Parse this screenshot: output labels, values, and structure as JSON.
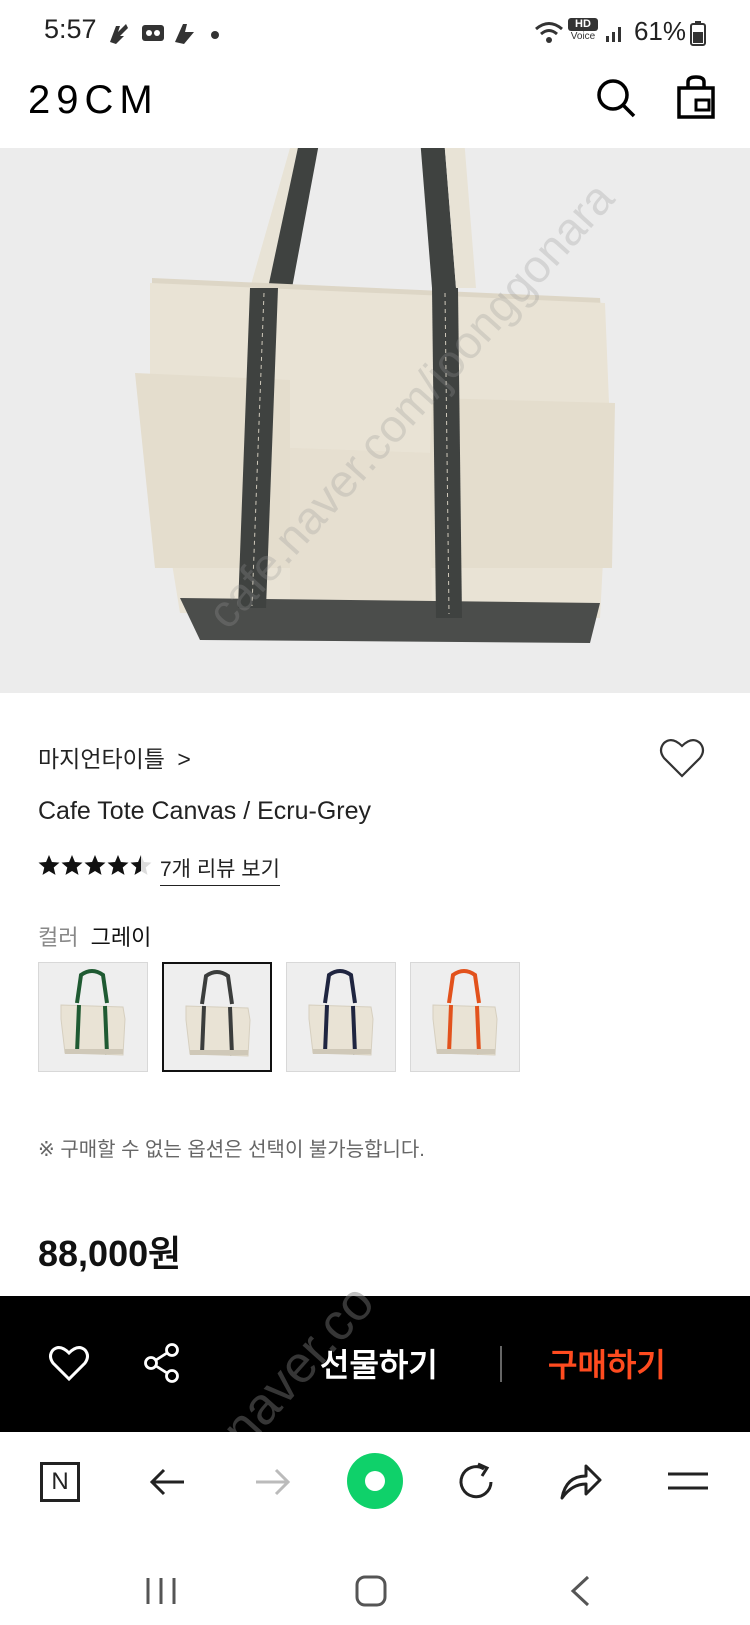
{
  "status_bar": {
    "time": "5:57",
    "battery": "61%",
    "hd_voice_top": "HD",
    "hd_voice_bottom": "Voice"
  },
  "header": {
    "logo": "29CM",
    "search_icon": "search-icon",
    "bag_icon": "shopping-bag-icon"
  },
  "product": {
    "brand": "마지언타이틀",
    "brand_chevron": ">",
    "title": "Cafe Tote Canvas / Ecru-Grey",
    "rating": 4.5,
    "rating_max": 5,
    "review_link": "7개 리뷰 보기",
    "color_label": "컬러",
    "color_value": "그레이",
    "swatches": [
      {
        "strap": "#1f5a32",
        "selected": false
      },
      {
        "strap": "#3b3d3c",
        "selected": true
      },
      {
        "strap": "#1f2540",
        "selected": false
      },
      {
        "strap": "#e2521c",
        "selected": false
      }
    ],
    "notice": "※ 구매할 수 없는 옵션은 선택이 불가능합니다.",
    "price": "88,000원"
  },
  "action_bar": {
    "gift_label": "선물하기",
    "buy_label": "구매하기",
    "buy_color": "#ff4b1f"
  },
  "browser_bar": {
    "home_label": "N"
  },
  "watermark": {
    "text1": "cafe.naver.com/joonggonara",
    "text2": "naver.co"
  }
}
